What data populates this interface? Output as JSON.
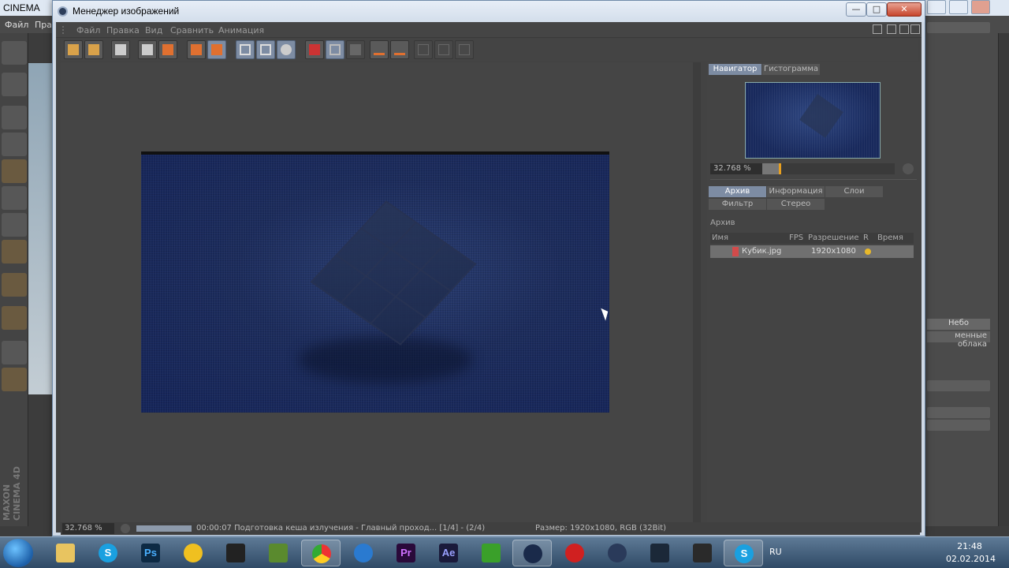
{
  "background_app": {
    "title": "CINEMA",
    "menu": [
      "Файл",
      "Пра"
    ],
    "maxon_label": "MAXON CINEMA 4D",
    "right_panel": {
      "sky": "Небо",
      "cloud": "менные облака"
    }
  },
  "window": {
    "title": "Менеджер изображений",
    "controls": {
      "minimize": "—",
      "maximize": "□",
      "close": "✕"
    }
  },
  "menu": [
    "Файл",
    "Правка",
    "Вид",
    "Сравнить",
    "Анимация"
  ],
  "toolbar_icons": [
    "open-icon",
    "save-icon",
    "film-icon",
    "grid-icon",
    "user-icon",
    "stack-icon",
    "stack-active-icon",
    "crop-a-icon",
    "crop-b-icon",
    "compare-icon",
    "ab-text-icon",
    "grid-select-icon",
    "ab-dim-icon",
    "a-marker-icon",
    "b-marker-icon",
    "split-h-icon",
    "split-v-icon",
    "split-grid-icon"
  ],
  "navigator": {
    "tabs": [
      "Навигатор",
      "Гистограмма"
    ],
    "zoom": "32.768 %",
    "zoom_fraction": 0.14
  },
  "info_tabs": {
    "row1": [
      "Архив",
      "Информация",
      "Слои"
    ],
    "row2": [
      "Фильтр",
      "Стерео"
    ]
  },
  "archive": {
    "heading": "Архив",
    "columns": [
      "Имя",
      "FPS",
      "Разрешение",
      "R",
      "Время"
    ],
    "rows": [
      {
        "name": "Кубик.jpg",
        "fps": "",
        "resolution": "1920x1080",
        "time": ""
      }
    ]
  },
  "status": {
    "zoom": "32.768 %",
    "progress_fraction": 1.0,
    "message": "00:00:07 Подготовка кеша излучения - Главный проход... [1/4] - (2/4)",
    "size": "Размер: 1920x1080, RGB (32Bit)"
  },
  "taskbar": {
    "apps": [
      "explorer",
      "skype",
      "photoshop",
      "archicad",
      "game",
      "minecraft",
      "chrome",
      "browser",
      "premiere",
      "after-effects",
      "media-player",
      "cinema4d",
      "record",
      "cinema4d-2",
      "steam",
      "counter-strike",
      "skype-2"
    ],
    "app_labels": {
      "photoshop": "Ps",
      "premiere": "Pr",
      "after-effects": "Ae",
      "skype": "S",
      "skype-2": "S"
    },
    "language": "RU",
    "time": "21:48",
    "date": "02.02.2014"
  }
}
